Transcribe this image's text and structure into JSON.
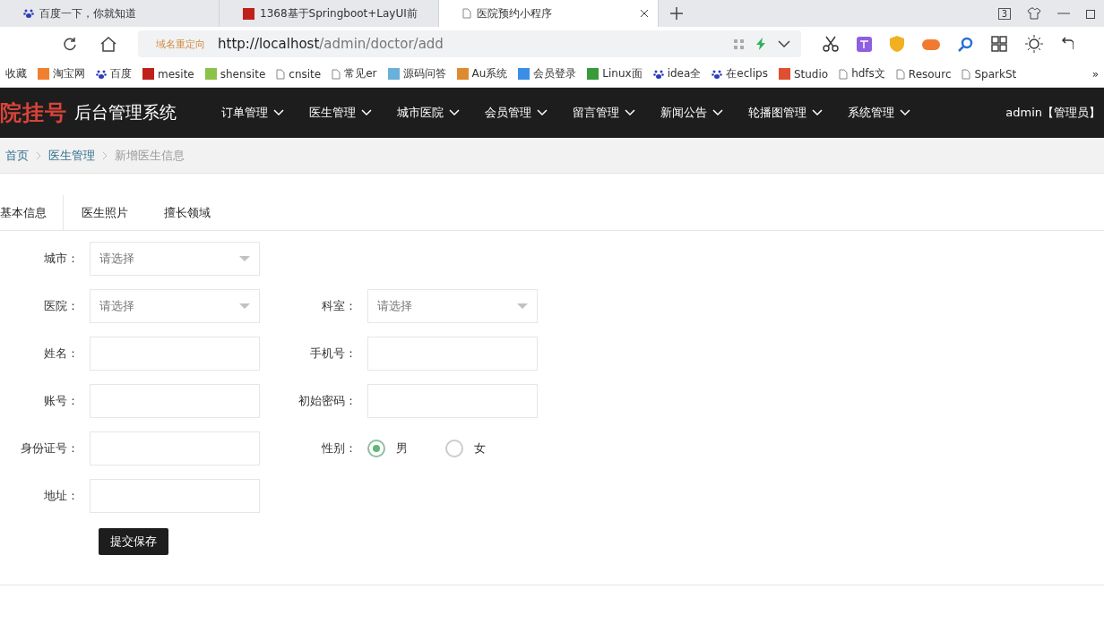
{
  "browser": {
    "tabs": [
      {
        "title": "百度一下，你就知道",
        "selected": false
      },
      {
        "title": "1368基于Springboot+LayUI前",
        "selected": false
      },
      {
        "title": "医院预约小程序",
        "selected": true
      }
    ],
    "tab_count": "3",
    "address": {
      "redirect_label": "域名重定向",
      "url_host": "http://localhost",
      "url_path": "/admin/doctor/add"
    },
    "bookmarks": [
      "收藏",
      "淘宝网",
      "百度",
      "mesite",
      "shensite",
      "cnsite",
      "常见er",
      "源码问答",
      "Au系统",
      "会员登录",
      "Linux面",
      "idea全",
      "在eclips",
      "Studio",
      "hdfs文",
      "Resourc",
      "SparkSt"
    ],
    "bookmarks_more": "»"
  },
  "header": {
    "logo": "院挂号",
    "subtitle": "后台管理系统",
    "nav": [
      "订单管理",
      "医生管理",
      "城市医院",
      "会员管理",
      "留言管理",
      "新闻公告",
      "轮播图管理",
      "系统管理"
    ],
    "user": "admin【管理员】"
  },
  "breadcrumb": [
    "首页",
    "医生管理",
    "新增医生信息"
  ],
  "form_tabs": [
    {
      "label": "基本信息",
      "selected": true
    },
    {
      "label": "医生照片",
      "selected": false
    },
    {
      "label": "擅长领域",
      "selected": false
    }
  ],
  "form_rows": [
    [
      {
        "kind": "select",
        "label": "城市：",
        "placeholder": "请选择"
      }
    ],
    [
      {
        "kind": "select",
        "label": "医院：",
        "placeholder": "请选择"
      },
      {
        "kind": "select",
        "label": "科室：",
        "placeholder": "请选择"
      }
    ],
    [
      {
        "kind": "text",
        "label": "姓名："
      },
      {
        "kind": "text",
        "label": "手机号："
      }
    ],
    [
      {
        "kind": "text",
        "label": "账号："
      },
      {
        "kind": "text",
        "label": "初始密码："
      }
    ],
    [
      {
        "kind": "text",
        "label": "身份证号："
      },
      {
        "kind": "radio",
        "label": "性别：",
        "options": [
          {
            "label": "男",
            "selected": true
          },
          {
            "label": "女",
            "selected": false
          }
        ]
      }
    ],
    [
      {
        "kind": "text",
        "label": "地址："
      }
    ]
  ],
  "submit": "提交保存"
}
